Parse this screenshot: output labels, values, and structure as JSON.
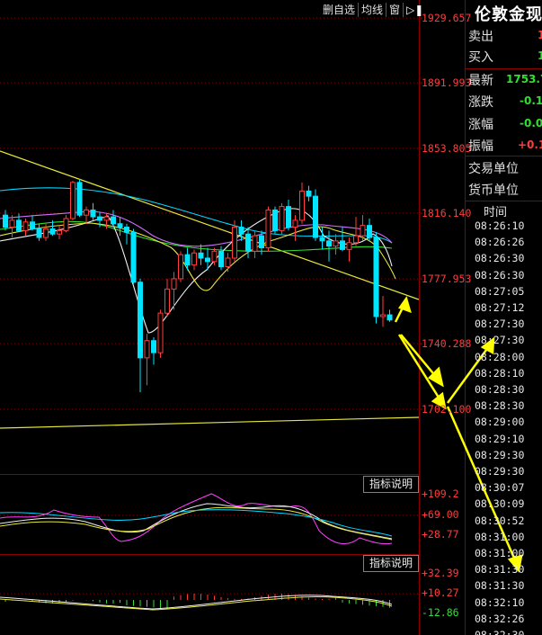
{
  "toolbar": {
    "delete_self_select": "删自选",
    "moving_average": "均线",
    "window": "窗"
  },
  "price_axis": [
    "1929.657",
    "1891.993",
    "1853.805",
    "1816.140",
    "1777.953",
    "1740.288",
    "1702.100"
  ],
  "indicator1": {
    "button": "指标说明",
    "labels": [
      "+109.2",
      "+69.00",
      "+28.77"
    ]
  },
  "indicator2": {
    "button": "指标说明",
    "labels": [
      "+32.39",
      "+10.27",
      "-12.86"
    ]
  },
  "quote": {
    "title": "伦敦金现",
    "sell_label": "卖出",
    "sell_value": "1",
    "buy_label": "买入",
    "buy_value": "1",
    "last_label": "最新",
    "last_value": "1753.7",
    "change_label": "涨跌",
    "change_value": "-0.1",
    "change_pct_label": "涨幅",
    "change_pct_value": "-0.0",
    "amplitude_label": "振幅",
    "amplitude_value": "+0.1",
    "trade_unit_label": "交易单位",
    "currency_unit_label": "货币单位"
  },
  "ticks": {
    "header": "时间",
    "times": [
      "08:26:10",
      "08:26:26",
      "08:26:30",
      "08:26:30",
      "08:27:05",
      "08:27:12",
      "08:27:30",
      "08:27:30",
      "08:28:00",
      "08:28:10",
      "08:28:30",
      "08:28:30",
      "08:29:00",
      "08:29:10",
      "08:29:30",
      "08:29:30",
      "08:30:07",
      "08:30:09",
      "08:30:52",
      "08:31:00",
      "08:31:00",
      "08:31:30",
      "08:31:30",
      "08:32:10",
      "08:32:26",
      "08:32:30"
    ]
  },
  "colors": {
    "up": "#ff3c3c",
    "down": "#00e5ff",
    "grid": "#8b0000",
    "trend": "#e6e63c",
    "arrow": "#ffff00"
  },
  "candles": [
    {
      "o": 1815,
      "h": 1818,
      "l": 1806,
      "c": 1808
    },
    {
      "o": 1808,
      "h": 1815,
      "l": 1802,
      "c": 1812
    },
    {
      "o": 1812,
      "h": 1816,
      "l": 1805,
      "c": 1806
    },
    {
      "o": 1806,
      "h": 1813,
      "l": 1803,
      "c": 1811
    },
    {
      "o": 1811,
      "h": 1815,
      "l": 1806,
      "c": 1807
    },
    {
      "o": 1807,
      "h": 1810,
      "l": 1800,
      "c": 1802
    },
    {
      "o": 1802,
      "h": 1810,
      "l": 1800,
      "c": 1807
    },
    {
      "o": 1807,
      "h": 1812,
      "l": 1803,
      "c": 1804
    },
    {
      "o": 1804,
      "h": 1809,
      "l": 1801,
      "c": 1806
    },
    {
      "o": 1806,
      "h": 1815,
      "l": 1805,
      "c": 1813
    },
    {
      "o": 1813,
      "h": 1835,
      "l": 1812,
      "c": 1834
    },
    {
      "o": 1834,
      "h": 1836,
      "l": 1814,
      "c": 1815
    },
    {
      "o": 1815,
      "h": 1820,
      "l": 1810,
      "c": 1818
    },
    {
      "o": 1818,
      "h": 1822,
      "l": 1812,
      "c": 1814
    },
    {
      "o": 1814,
      "h": 1817,
      "l": 1808,
      "c": 1812
    },
    {
      "o": 1812,
      "h": 1816,
      "l": 1807,
      "c": 1814
    },
    {
      "o": 1814,
      "h": 1818,
      "l": 1808,
      "c": 1810
    },
    {
      "o": 1810,
      "h": 1814,
      "l": 1803,
      "c": 1808
    },
    {
      "o": 1808,
      "h": 1810,
      "l": 1798,
      "c": 1805
    },
    {
      "o": 1805,
      "h": 1807,
      "l": 1775,
      "c": 1776
    },
    {
      "o": 1776,
      "h": 1778,
      "l": 1712,
      "c": 1732
    },
    {
      "o": 1732,
      "h": 1746,
      "l": 1716,
      "c": 1742
    },
    {
      "o": 1742,
      "h": 1744,
      "l": 1728,
      "c": 1735
    },
    {
      "o": 1735,
      "h": 1760,
      "l": 1732,
      "c": 1758
    },
    {
      "o": 1758,
      "h": 1778,
      "l": 1756,
      "c": 1772
    },
    {
      "o": 1772,
      "h": 1782,
      "l": 1760,
      "c": 1778
    },
    {
      "o": 1778,
      "h": 1794,
      "l": 1776,
      "c": 1792
    },
    {
      "o": 1792,
      "h": 1796,
      "l": 1783,
      "c": 1786
    },
    {
      "o": 1786,
      "h": 1795,
      "l": 1783,
      "c": 1793
    },
    {
      "o": 1793,
      "h": 1798,
      "l": 1786,
      "c": 1790
    },
    {
      "o": 1790,
      "h": 1796,
      "l": 1783,
      "c": 1788
    },
    {
      "o": 1788,
      "h": 1796,
      "l": 1786,
      "c": 1794
    },
    {
      "o": 1794,
      "h": 1797,
      "l": 1783,
      "c": 1785
    },
    {
      "o": 1785,
      "h": 1793,
      "l": 1782,
      "c": 1790
    },
    {
      "o": 1790,
      "h": 1812,
      "l": 1788,
      "c": 1808
    },
    {
      "o": 1808,
      "h": 1812,
      "l": 1800,
      "c": 1804
    },
    {
      "o": 1804,
      "h": 1808,
      "l": 1790,
      "c": 1794
    },
    {
      "o": 1794,
      "h": 1806,
      "l": 1790,
      "c": 1803
    },
    {
      "o": 1803,
      "h": 1806,
      "l": 1792,
      "c": 1796
    },
    {
      "o": 1796,
      "h": 1820,
      "l": 1794,
      "c": 1818
    },
    {
      "o": 1818,
      "h": 1820,
      "l": 1804,
      "c": 1806
    },
    {
      "o": 1806,
      "h": 1822,
      "l": 1804,
      "c": 1820
    },
    {
      "o": 1820,
      "h": 1824,
      "l": 1806,
      "c": 1808
    },
    {
      "o": 1808,
      "h": 1815,
      "l": 1800,
      "c": 1812
    },
    {
      "o": 1812,
      "h": 1834,
      "l": 1810,
      "c": 1829
    },
    {
      "o": 1829,
      "h": 1832,
      "l": 1823,
      "c": 1826
    },
    {
      "o": 1826,
      "h": 1830,
      "l": 1800,
      "c": 1802
    },
    {
      "o": 1802,
      "h": 1808,
      "l": 1795,
      "c": 1800
    },
    {
      "o": 1800,
      "h": 1806,
      "l": 1788,
      "c": 1797
    },
    {
      "o": 1797,
      "h": 1804,
      "l": 1792,
      "c": 1800
    },
    {
      "o": 1800,
      "h": 1808,
      "l": 1794,
      "c": 1795
    },
    {
      "o": 1795,
      "h": 1802,
      "l": 1788,
      "c": 1799
    },
    {
      "o": 1799,
      "h": 1814,
      "l": 1797,
      "c": 1803
    },
    {
      "o": 1803,
      "h": 1815,
      "l": 1800,
      "c": 1809
    },
    {
      "o": 1809,
      "h": 1813,
      "l": 1800,
      "c": 1802
    },
    {
      "o": 1802,
      "h": 1805,
      "l": 1752,
      "c": 1756
    },
    {
      "o": 1756,
      "h": 1768,
      "l": 1750,
      "c": 1757
    },
    {
      "o": 1757,
      "h": 1760,
      "l": 1753,
      "c": 1754
    }
  ]
}
